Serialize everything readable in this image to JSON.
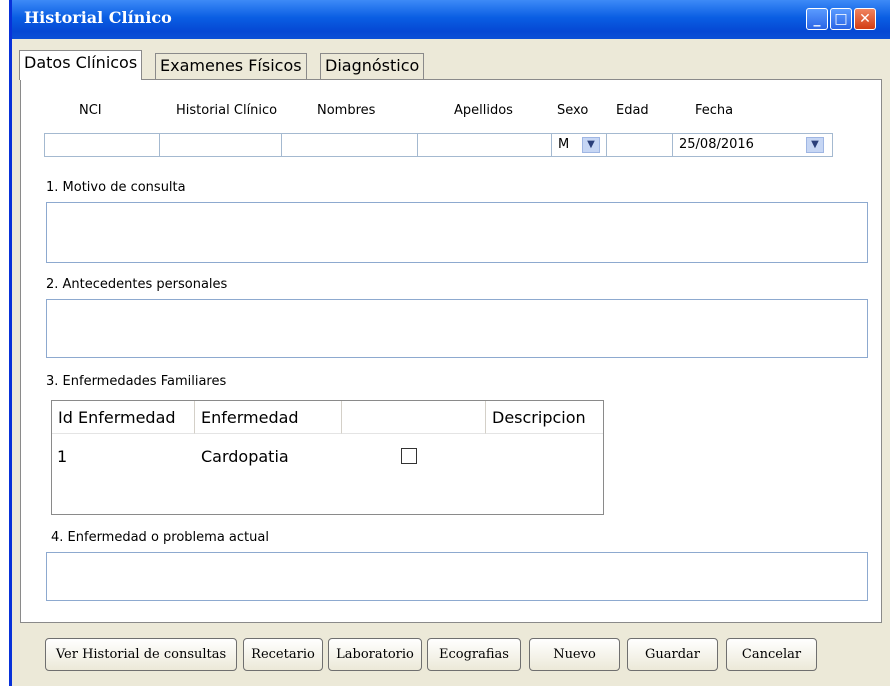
{
  "window": {
    "title": "Historial Clínico"
  },
  "tabs": [
    {
      "label": "Datos Clínicos"
    },
    {
      "label": "Examenes Físicos"
    },
    {
      "label": "Diagnóstico"
    }
  ],
  "patient": {
    "headers": {
      "nci": "NCI",
      "historial": "Historial Clínico",
      "nombres": "Nombres",
      "apellidos": "Apellidos",
      "sexo": "Sexo",
      "edad": "Edad",
      "fecha": "Fecha"
    },
    "values": {
      "nci": "",
      "historial": "",
      "nombres": "",
      "apellidos": "",
      "sexo": "M",
      "edad": "",
      "fecha": "25/08/2016"
    }
  },
  "sections": {
    "motivo": "1. Motivo de consulta",
    "antecedentes": "2. Antecedentes personales",
    "familiares": "3. Enfermedades Familiares",
    "actual": "4. Enfermedad o problema actual"
  },
  "family_table": {
    "columns": [
      "Id Enfermedad",
      "Enfermedad",
      "",
      "Descripcion"
    ],
    "rows": [
      {
        "id": "1",
        "enfermedad": "Cardopatia",
        "checked": false,
        "descripcion": ""
      }
    ]
  },
  "buttons": {
    "historial": "Ver Historial de consultas",
    "recetario": "Recetario",
    "laboratorio": "Laboratorio",
    "ecografias": "Ecografias",
    "nuevo": "Nuevo",
    "guardar": "Guardar",
    "cancelar": "Cancelar"
  }
}
